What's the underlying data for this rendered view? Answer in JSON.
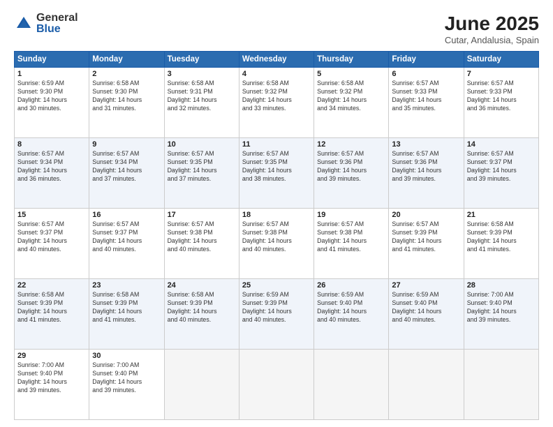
{
  "logo": {
    "general": "General",
    "blue": "Blue"
  },
  "title": "June 2025",
  "subtitle": "Cutar, Andalusia, Spain",
  "header_days": [
    "Sunday",
    "Monday",
    "Tuesday",
    "Wednesday",
    "Thursday",
    "Friday",
    "Saturday"
  ],
  "weeks": [
    [
      {
        "day": "1",
        "lines": [
          "Sunrise: 6:59 AM",
          "Sunset: 9:30 PM",
          "Daylight: 14 hours",
          "and 30 minutes."
        ]
      },
      {
        "day": "2",
        "lines": [
          "Sunrise: 6:58 AM",
          "Sunset: 9:30 PM",
          "Daylight: 14 hours",
          "and 31 minutes."
        ]
      },
      {
        "day": "3",
        "lines": [
          "Sunrise: 6:58 AM",
          "Sunset: 9:31 PM",
          "Daylight: 14 hours",
          "and 32 minutes."
        ]
      },
      {
        "day": "4",
        "lines": [
          "Sunrise: 6:58 AM",
          "Sunset: 9:32 PM",
          "Daylight: 14 hours",
          "and 33 minutes."
        ]
      },
      {
        "day": "5",
        "lines": [
          "Sunrise: 6:58 AM",
          "Sunset: 9:32 PM",
          "Daylight: 14 hours",
          "and 34 minutes."
        ]
      },
      {
        "day": "6",
        "lines": [
          "Sunrise: 6:57 AM",
          "Sunset: 9:33 PM",
          "Daylight: 14 hours",
          "and 35 minutes."
        ]
      },
      {
        "day": "7",
        "lines": [
          "Sunrise: 6:57 AM",
          "Sunset: 9:33 PM",
          "Daylight: 14 hours",
          "and 36 minutes."
        ]
      }
    ],
    [
      {
        "day": "8",
        "lines": [
          "Sunrise: 6:57 AM",
          "Sunset: 9:34 PM",
          "Daylight: 14 hours",
          "and 36 minutes."
        ]
      },
      {
        "day": "9",
        "lines": [
          "Sunrise: 6:57 AM",
          "Sunset: 9:34 PM",
          "Daylight: 14 hours",
          "and 37 minutes."
        ]
      },
      {
        "day": "10",
        "lines": [
          "Sunrise: 6:57 AM",
          "Sunset: 9:35 PM",
          "Daylight: 14 hours",
          "and 37 minutes."
        ]
      },
      {
        "day": "11",
        "lines": [
          "Sunrise: 6:57 AM",
          "Sunset: 9:35 PM",
          "Daylight: 14 hours",
          "and 38 minutes."
        ]
      },
      {
        "day": "12",
        "lines": [
          "Sunrise: 6:57 AM",
          "Sunset: 9:36 PM",
          "Daylight: 14 hours",
          "and 39 minutes."
        ]
      },
      {
        "day": "13",
        "lines": [
          "Sunrise: 6:57 AM",
          "Sunset: 9:36 PM",
          "Daylight: 14 hours",
          "and 39 minutes."
        ]
      },
      {
        "day": "14",
        "lines": [
          "Sunrise: 6:57 AM",
          "Sunset: 9:37 PM",
          "Daylight: 14 hours",
          "and 39 minutes."
        ]
      }
    ],
    [
      {
        "day": "15",
        "lines": [
          "Sunrise: 6:57 AM",
          "Sunset: 9:37 PM",
          "Daylight: 14 hours",
          "and 40 minutes."
        ]
      },
      {
        "day": "16",
        "lines": [
          "Sunrise: 6:57 AM",
          "Sunset: 9:37 PM",
          "Daylight: 14 hours",
          "and 40 minutes."
        ]
      },
      {
        "day": "17",
        "lines": [
          "Sunrise: 6:57 AM",
          "Sunset: 9:38 PM",
          "Daylight: 14 hours",
          "and 40 minutes."
        ]
      },
      {
        "day": "18",
        "lines": [
          "Sunrise: 6:57 AM",
          "Sunset: 9:38 PM",
          "Daylight: 14 hours",
          "and 40 minutes."
        ]
      },
      {
        "day": "19",
        "lines": [
          "Sunrise: 6:57 AM",
          "Sunset: 9:38 PM",
          "Daylight: 14 hours",
          "and 41 minutes."
        ]
      },
      {
        "day": "20",
        "lines": [
          "Sunrise: 6:57 AM",
          "Sunset: 9:39 PM",
          "Daylight: 14 hours",
          "and 41 minutes."
        ]
      },
      {
        "day": "21",
        "lines": [
          "Sunrise: 6:58 AM",
          "Sunset: 9:39 PM",
          "Daylight: 14 hours",
          "and 41 minutes."
        ]
      }
    ],
    [
      {
        "day": "22",
        "lines": [
          "Sunrise: 6:58 AM",
          "Sunset: 9:39 PM",
          "Daylight: 14 hours",
          "and 41 minutes."
        ]
      },
      {
        "day": "23",
        "lines": [
          "Sunrise: 6:58 AM",
          "Sunset: 9:39 PM",
          "Daylight: 14 hours",
          "and 41 minutes."
        ]
      },
      {
        "day": "24",
        "lines": [
          "Sunrise: 6:58 AM",
          "Sunset: 9:39 PM",
          "Daylight: 14 hours",
          "and 40 minutes."
        ]
      },
      {
        "day": "25",
        "lines": [
          "Sunrise: 6:59 AM",
          "Sunset: 9:39 PM",
          "Daylight: 14 hours",
          "and 40 minutes."
        ]
      },
      {
        "day": "26",
        "lines": [
          "Sunrise: 6:59 AM",
          "Sunset: 9:40 PM",
          "Daylight: 14 hours",
          "and 40 minutes."
        ]
      },
      {
        "day": "27",
        "lines": [
          "Sunrise: 6:59 AM",
          "Sunset: 9:40 PM",
          "Daylight: 14 hours",
          "and 40 minutes."
        ]
      },
      {
        "day": "28",
        "lines": [
          "Sunrise: 7:00 AM",
          "Sunset: 9:40 PM",
          "Daylight: 14 hours",
          "and 39 minutes."
        ]
      }
    ],
    [
      {
        "day": "29",
        "lines": [
          "Sunrise: 7:00 AM",
          "Sunset: 9:40 PM",
          "Daylight: 14 hours",
          "and 39 minutes."
        ]
      },
      {
        "day": "30",
        "lines": [
          "Sunrise: 7:00 AM",
          "Sunset: 9:40 PM",
          "Daylight: 14 hours",
          "and 39 minutes."
        ]
      },
      {
        "day": "",
        "lines": []
      },
      {
        "day": "",
        "lines": []
      },
      {
        "day": "",
        "lines": []
      },
      {
        "day": "",
        "lines": []
      },
      {
        "day": "",
        "lines": []
      }
    ]
  ]
}
